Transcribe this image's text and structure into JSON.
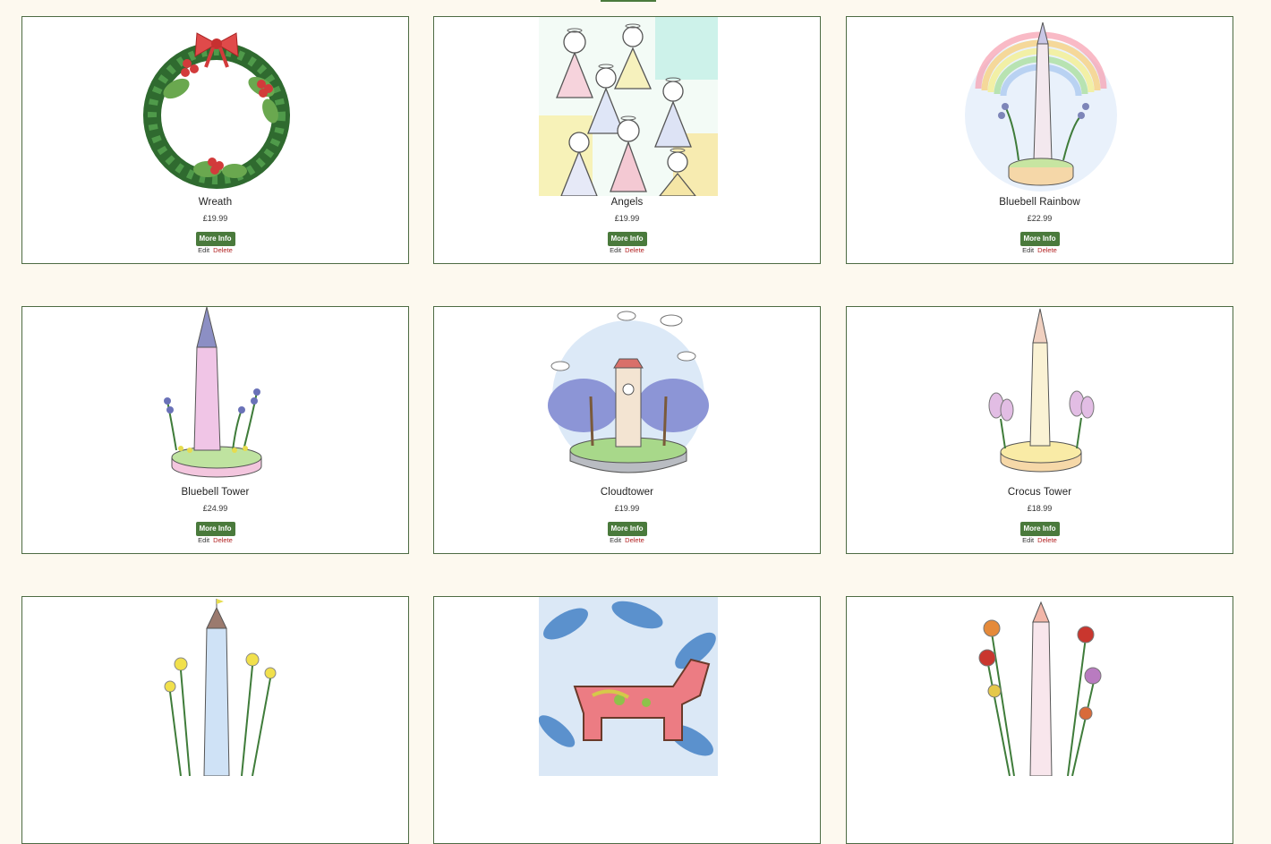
{
  "products": [
    {
      "title": "Wreath",
      "price": "£19.99",
      "button": "More Info",
      "edit": "Edit",
      "delete": "Delete"
    },
    {
      "title": "Angels",
      "price": "£19.99",
      "button": "More Info",
      "edit": "Edit",
      "delete": "Delete"
    },
    {
      "title": "Bluebell Rainbow",
      "price": "£22.99",
      "button": "More Info",
      "edit": "Edit",
      "delete": "Delete"
    },
    {
      "title": "Bluebell Tower",
      "price": "£24.99",
      "button": "More Info",
      "edit": "Edit",
      "delete": "Delete"
    },
    {
      "title": "Cloudtower",
      "price": "£19.99",
      "button": "More Info",
      "edit": "Edit",
      "delete": "Delete"
    },
    {
      "title": "Crocus Tower",
      "price": "£18.99",
      "button": "More Info",
      "edit": "Edit",
      "delete": "Delete"
    }
  ],
  "colors": {
    "background": "#fdf9ef",
    "button": "#4a7a3c",
    "card_border": "#4d6b43",
    "delete_link": "#b22222"
  }
}
